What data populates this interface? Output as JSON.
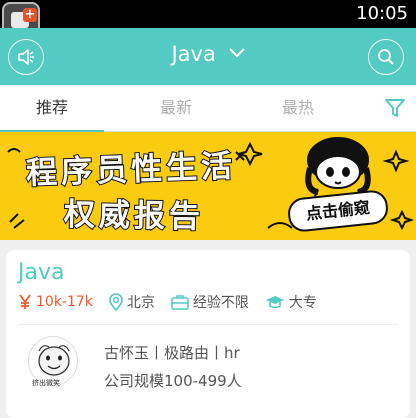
{
  "status_bar": {
    "time": "10:05"
  },
  "header": {
    "title": "Java"
  },
  "tabs": [
    {
      "label": "推荐",
      "active": true
    },
    {
      "label": "最新",
      "active": false
    },
    {
      "label": "最热",
      "active": false
    }
  ],
  "banner": {
    "line1": "程序员性生活",
    "line2": "权威报告",
    "stamp": "点击偷窥"
  },
  "job": {
    "title": "Java",
    "salary": "10k-17k",
    "city": "北京",
    "experience": "经验不限",
    "education": "大专",
    "avatar_caption": "挤出微笑",
    "company_line": "古怀玉丨极路由丨hr",
    "company_size": "公司规模100-499人"
  },
  "colors": {
    "accent": "#53cac2",
    "salary": "#f2582b",
    "banner": "#fbcb10"
  }
}
